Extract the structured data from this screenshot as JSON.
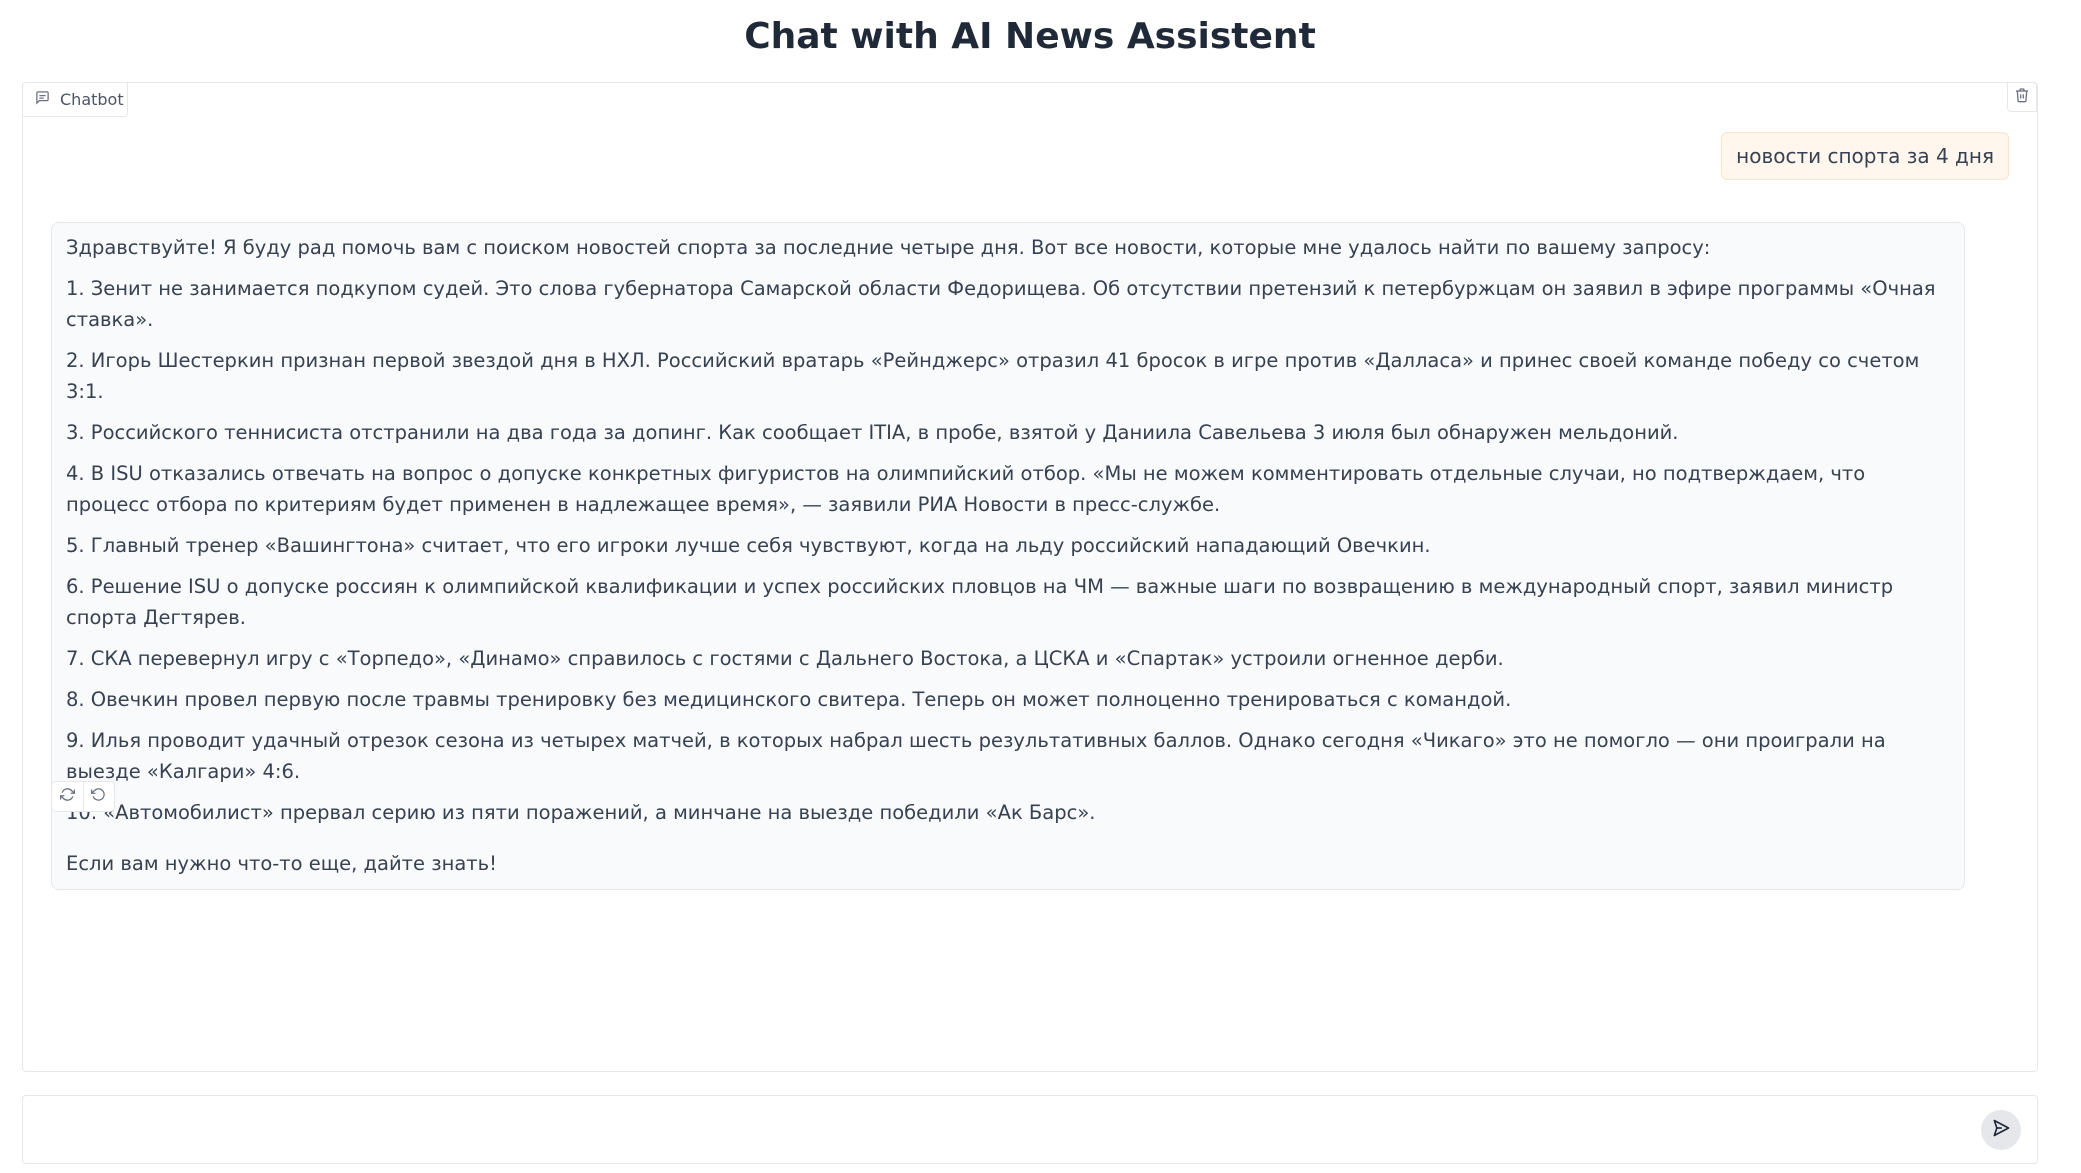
{
  "page": {
    "title": "Chat with AI News Assistent"
  },
  "chatbot": {
    "tab_label": "Chatbot",
    "icons": {
      "tab": "chat-bubble-icon",
      "clear": "trash-icon",
      "retry": "refresh-icon",
      "undo": "undo-icon",
      "send": "send-arrow-icon"
    },
    "user_message": "новости спорта за 4 дня",
    "bot_message": {
      "intro": "Здравствуйте! Я буду рад помочь вам с поиском новостей спорта за последние четыре дня. Вот все новости, которые мне удалось найти по вашему запросу:",
      "items": [
        "1. Зенит не занимается подкупом судей. Это слова губернатора Самарской области Федорищева. Об отсутствии претензий к петербуржцам он заявил в эфире программы «Очная ставка».",
        "2. Игорь Шестеркин признан первой звездой дня в НХЛ. Российский вратарь «Рейнджерс» отразил 41 бросок в игре против «Далласа» и принес своей команде победу со счетом 3:1.",
        "3. Российского теннисиста отстранили на два года за допинг. Как сообщает ITIA, в пробе, взятой у Даниила Савельева 3 июля был обнаружен мельдоний.",
        "4. В ISU отказались отвечать на вопрос о допуске конкретных фигуристов на олимпийский отбор. «Мы не можем комментировать отдельные случаи, но подтверждаем, что процесс отбора по критериям будет применен в надлежащее время», — заявили РИА Новости в пресс-службе.",
        "5. Главный тренер «Вашингтона» считает, что его игроки лучше себя чувствуют, когда на льду российский нападающий Овечкин.",
        "6. Решение ISU о допуске россиян к олимпийской квалификации и успех российских пловцов на ЧМ — важные шаги по возвращению в международный спорт, заявил министр спорта Дегтярев.",
        "7. СКА перевернул игру с «Торпедо», «Динамо» справилось с гостями с Дальнего Востока, а ЦСКА и «Спартак» устроили огненное дерби.",
        "8. Овечкин провел первую после травмы тренировку без медицинского свитера. Теперь он может полноценно тренироваться с командой.",
        "9. Илья проводит удачный отрезок сезона из четырех матчей, в которых набрал шесть результативных баллов. Однако сегодня «Чикаго» это не помогло — они проиграли на выезде «Калгари» 4:6.",
        "10. «Автомобилист» прервал серию из пяти поражений, а минчане на выезде победили «Ак Барс»."
      ],
      "closing": "Если вам нужно что-то еще, дайте знать!"
    }
  },
  "input": {
    "value": "",
    "placeholder": ""
  },
  "colors": {
    "user_bubble_bg": "#fff7ed",
    "bot_bubble_bg": "#f9fafb",
    "border": "#e5e7eb"
  }
}
